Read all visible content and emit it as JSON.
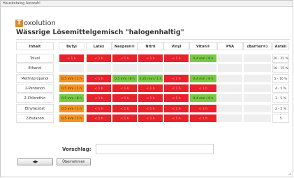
{
  "window": {
    "title": "Hauskatalog Auswahl"
  },
  "brand": {
    "logo_letter": "T",
    "logo_text": "oxolution"
  },
  "heading": "Wässrige Lösemittelgemisch \"halogenhaltig\"",
  "table": {
    "headers": [
      "Inhalt",
      "Butyl",
      "Latex",
      "Neopren®",
      "Nitril",
      "Vinyl",
      "Viton®",
      "PVA",
      "(Barrier®)",
      "Anteil"
    ],
    "rows": [
      {
        "name": "Toluol",
        "anteil": "20 - 25 %",
        "cells": [
          {
            "text": "< 1 h",
            "status": "red"
          },
          {
            "text": "< 1 h",
            "status": "red"
          },
          {
            "text": "< 1 h",
            "status": "red"
          },
          {
            "text": "< 1 h",
            "status": "red"
          },
          {
            "text": "< 1 h",
            "status": "red"
          },
          {
            "text": "0,4 mm / 8 h",
            "status": "green"
          },
          {
            "text": "",
            "status": "empty"
          },
          {
            "text": "",
            "status": "empty"
          }
        ]
      },
      {
        "name": "Ethanol",
        "anteil": "10 - 15 %",
        "cells": [
          {
            "text": "",
            "status": "empty"
          },
          {
            "text": "",
            "status": "empty"
          },
          {
            "text": "",
            "status": "empty"
          },
          {
            "text": "",
            "status": "empty"
          },
          {
            "text": "",
            "status": "empty"
          },
          {
            "text": "",
            "status": "empty"
          },
          {
            "text": "",
            "status": "empty"
          },
          {
            "text": "",
            "status": "empty"
          }
        ]
      },
      {
        "name": "Methylpropanol",
        "anteil": "5 - 10 %",
        "cells": [
          {
            "text": "0,5 mm / 1 h",
            "status": "orange"
          },
          {
            "text": "< 1 h",
            "status": "red"
          },
          {
            "text": "0,5 mm / 8 h",
            "status": "green"
          },
          {
            "text": "0,35 mm / 1 h",
            "status": "green"
          },
          {
            "text": "< 1 h",
            "status": "red"
          },
          {
            "text": "0,4 mm / 8 h",
            "status": "green"
          },
          {
            "text": "",
            "status": "empty"
          },
          {
            "text": "",
            "status": "empty"
          }
        ]
      },
      {
        "name": "2-Pentanon",
        "anteil": "4 - 5 %",
        "cells": [
          {
            "text": "0,5 mm / 1 h",
            "status": "orange"
          },
          {
            "text": "< 1 h",
            "status": "red"
          },
          {
            "text": "< 1 h",
            "status": "red"
          },
          {
            "text": "< 1 h",
            "status": "red"
          },
          {
            "text": "< 1 h",
            "status": "red"
          },
          {
            "text": "< 1 h",
            "status": "red"
          },
          {
            "text": "",
            "status": "empty"
          },
          {
            "text": "",
            "status": "empty"
          }
        ]
      },
      {
        "name": "2-Chlorethin",
        "anteil": "3 - 5 %",
        "cells": [
          {
            "text": "0,5 mm / 8 h",
            "status": "green"
          },
          {
            "text": "< 1 h",
            "status": "red"
          },
          {
            "text": "< 1 h",
            "status": "red"
          },
          {
            "text": "< 1 h",
            "status": "red"
          },
          {
            "text": "< 1 h",
            "status": "red"
          },
          {
            "text": "0,4 mm / 8 h",
            "status": "green"
          },
          {
            "text": "",
            "status": "empty"
          },
          {
            "text": "",
            "status": "empty"
          }
        ]
      },
      {
        "name": "Ethylacetat",
        "anteil": "2 - 5 %",
        "cells": [
          {
            "text": "0,5 mm / 1 h",
            "status": "orange"
          },
          {
            "text": "< 1 h",
            "status": "red"
          },
          {
            "text": "< 1 h",
            "status": "red"
          },
          {
            "text": "< 1 h",
            "status": "red"
          },
          {
            "text": "< 1 h",
            "status": "red"
          },
          {
            "text": "< 1 h",
            "status": "red"
          },
          {
            "text": "",
            "status": "empty"
          },
          {
            "text": "",
            "status": "empty"
          }
        ]
      },
      {
        "name": "2-Butanon",
        "anteil": "5",
        "cells": [
          {
            "text": "0,5 mm / 1 h",
            "status": "orange"
          },
          {
            "text": "< 1 h",
            "status": "red"
          },
          {
            "text": "< 1 h",
            "status": "red"
          },
          {
            "text": "< 1 h",
            "status": "red"
          },
          {
            "text": "< 1 h",
            "status": "red"
          },
          {
            "text": "< 1 h",
            "status": "red"
          },
          {
            "text": "",
            "status": "empty"
          },
          {
            "text": "",
            "status": "empty"
          }
        ]
      }
    ]
  },
  "vorschlag": {
    "label": "Vorschlag:",
    "value": ""
  },
  "buttons": {
    "back_label": "◀▶",
    "apply_label": "Übernehmen"
  },
  "colors": {
    "green": "#7ac943",
    "orange": "#f29423",
    "red": "#e8212b",
    "empty": "#efefef"
  }
}
